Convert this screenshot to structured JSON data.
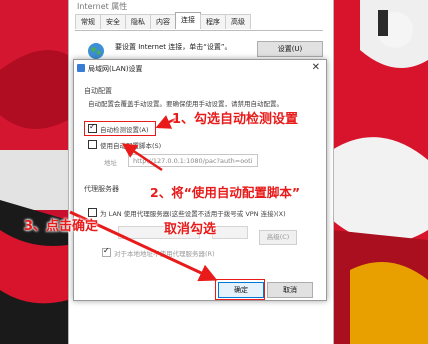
{
  "internet_options": {
    "title": "Internet 属性",
    "tabs": [
      "常规",
      "安全",
      "隐私",
      "内容",
      "连接",
      "程序",
      "高级"
    ],
    "active_tab": "连接",
    "setup_text": "要设置 Internet 连接，单击“设置”。",
    "setup_button": "设置(U)"
  },
  "lan_dialog": {
    "title": "局域网(LAN)设置",
    "auto_config_group": "自动配置",
    "auto_config_desc": "自动配置会覆盖手动设置。要确保使用手动设置，请禁用自动配置。",
    "auto_detect_label": "自动检测设置(A)",
    "auto_detect_checked": true,
    "use_script_label": "使用自动配置脚本(S)",
    "use_script_checked": false,
    "address_label": "地址",
    "address_value": "http://127.0.0.1:1080/pac?auth=ooti",
    "proxy_group": "代理服务器",
    "use_proxy_label": "为 LAN 使用代理服务器(这些设置不适用于拨号或 VPN 连接)(X)",
    "use_proxy_checked": false,
    "advanced_button": "高级(C)",
    "bypass_local_label": "对于本地地址不使用代理服务器(R)",
    "ok_button": "确定",
    "cancel_button": "取消"
  },
  "annotations": {
    "step1": "1、勾选自动检测设置",
    "step2_line1": "2、将“使用自动配置脚本”",
    "step2_line2": "取消勾选",
    "step3": "3、点击确定"
  },
  "colors": {
    "annotation_red": "#e81a1a",
    "background_red": "#c8102e",
    "ok_blue": "#0078d7"
  }
}
